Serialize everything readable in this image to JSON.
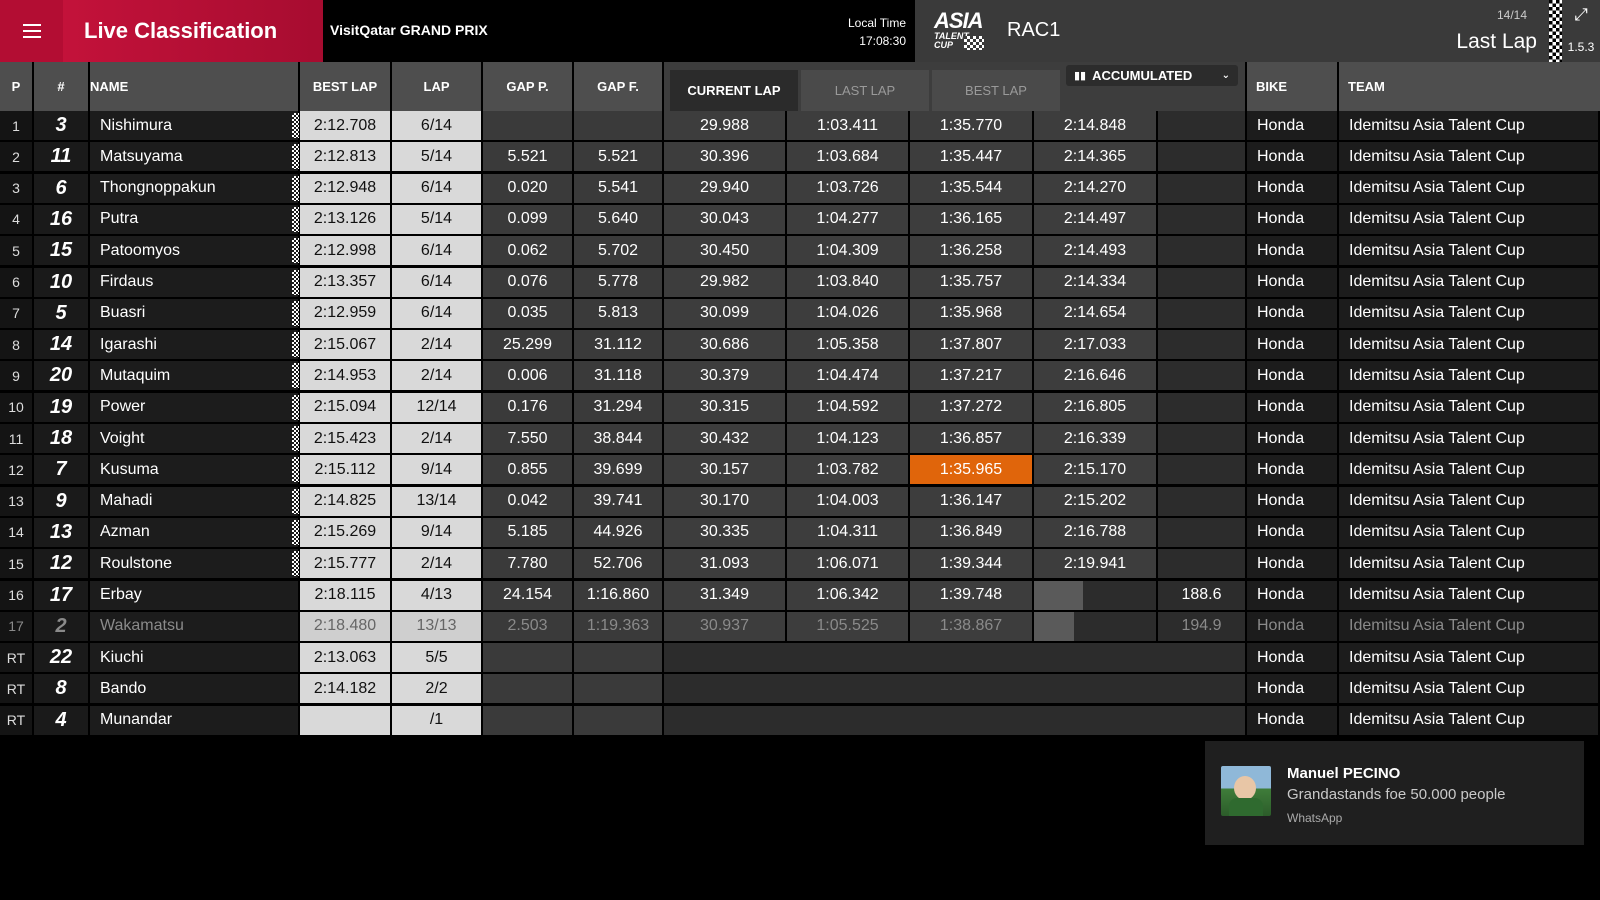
{
  "header": {
    "title": "Live Classification",
    "event": "VisitQatar GRAND PRIX",
    "local_time_label": "Local Time",
    "local_time": "17:08:30",
    "logo_line1": "ASIA",
    "logo_line2": "TALENT",
    "logo_line3": "CUP",
    "session": "RAC1",
    "lap_count": "14/14",
    "lap_mode": "Last Lap",
    "version": "1.5.3"
  },
  "columns": {
    "p": "P",
    "num": "#",
    "name": "NAME",
    "best_lap": "BEST LAP",
    "lap": "LAP",
    "gap_p": "GAP P.",
    "gap_f": "GAP F.",
    "bike": "BIKE",
    "team": "TEAM"
  },
  "sector_tabs": [
    "CURRENT LAP",
    "LAST LAP",
    "BEST LAP"
  ],
  "accumulated_label": "ACCUMULATED",
  "rows": [
    {
      "p": "1",
      "num": "3",
      "name": "Nishimura",
      "best": "2:12.708",
      "lap": "6/14",
      "gap_p": "",
      "gap_f": "",
      "s1": "29.988",
      "s2": "1:03.411",
      "s3": "1:35.770",
      "s4": "2:14.848",
      "speed": "",
      "bike": "Honda",
      "team": "Idemitsu Asia Talent Cup",
      "flag": true
    },
    {
      "p": "2",
      "num": "11",
      "name": "Matsuyama",
      "best": "2:12.813",
      "lap": "5/14",
      "gap_p": "5.521",
      "gap_f": "5.521",
      "s1": "30.396",
      "s2": "1:03.684",
      "s3": "1:35.447",
      "s4": "2:14.365",
      "speed": "",
      "bike": "Honda",
      "team": "Idemitsu Asia Talent Cup",
      "flag": true
    },
    {
      "p": "3",
      "num": "6",
      "name": "Thongnoppakun",
      "best": "2:12.948",
      "lap": "6/14",
      "gap_p": "0.020",
      "gap_f": "5.541",
      "s1": "29.940",
      "s2": "1:03.726",
      "s3": "1:35.544",
      "s4": "2:14.270",
      "speed": "",
      "bike": "Honda",
      "team": "Idemitsu Asia Talent Cup",
      "flag": true
    },
    {
      "p": "4",
      "num": "16",
      "name": "Putra",
      "best": "2:13.126",
      "lap": "5/14",
      "gap_p": "0.099",
      "gap_f": "5.640",
      "s1": "30.043",
      "s2": "1:04.277",
      "s3": "1:36.165",
      "s4": "2:14.497",
      "speed": "",
      "bike": "Honda",
      "team": "Idemitsu Asia Talent Cup",
      "flag": true
    },
    {
      "p": "5",
      "num": "15",
      "name": "Patoomyos",
      "best": "2:12.998",
      "lap": "6/14",
      "gap_p": "0.062",
      "gap_f": "5.702",
      "s1": "30.450",
      "s2": "1:04.309",
      "s3": "1:36.258",
      "s4": "2:14.493",
      "speed": "",
      "bike": "Honda",
      "team": "Idemitsu Asia Talent Cup",
      "flag": true
    },
    {
      "p": "6",
      "num": "10",
      "name": "Firdaus",
      "best": "2:13.357",
      "lap": "6/14",
      "gap_p": "0.076",
      "gap_f": "5.778",
      "s1": "29.982",
      "s2": "1:03.840",
      "s3": "1:35.757",
      "s4": "2:14.334",
      "speed": "",
      "bike": "Honda",
      "team": "Idemitsu Asia Talent Cup",
      "flag": true
    },
    {
      "p": "7",
      "num": "5",
      "name": "Buasri",
      "best": "2:12.959",
      "lap": "6/14",
      "gap_p": "0.035",
      "gap_f": "5.813",
      "s1": "30.099",
      "s2": "1:04.026",
      "s3": "1:35.968",
      "s4": "2:14.654",
      "speed": "",
      "bike": "Honda",
      "team": "Idemitsu Asia Talent Cup",
      "flag": true
    },
    {
      "p": "8",
      "num": "14",
      "name": "Igarashi",
      "best": "2:15.067",
      "lap": "2/14",
      "gap_p": "25.299",
      "gap_f": "31.112",
      "s1": "30.686",
      "s2": "1:05.358",
      "s3": "1:37.807",
      "s4": "2:17.033",
      "speed": "",
      "bike": "Honda",
      "team": "Idemitsu Asia Talent Cup",
      "flag": true
    },
    {
      "p": "9",
      "num": "20",
      "name": "Mutaquim",
      "best": "2:14.953",
      "lap": "2/14",
      "gap_p": "0.006",
      "gap_f": "31.118",
      "s1": "30.379",
      "s2": "1:04.474",
      "s3": "1:37.217",
      "s4": "2:16.646",
      "speed": "",
      "bike": "Honda",
      "team": "Idemitsu Asia Talent Cup",
      "flag": true
    },
    {
      "p": "10",
      "num": "19",
      "name": "Power",
      "best": "2:15.094",
      "lap": "12/14",
      "gap_p": "0.176",
      "gap_f": "31.294",
      "s1": "30.315",
      "s2": "1:04.592",
      "s3": "1:37.272",
      "s4": "2:16.805",
      "speed": "",
      "bike": "Honda",
      "team": "Idemitsu Asia Talent Cup",
      "flag": true
    },
    {
      "p": "11",
      "num": "18",
      "name": "Voight",
      "best": "2:15.423",
      "lap": "2/14",
      "gap_p": "7.550",
      "gap_f": "38.844",
      "s1": "30.432",
      "s2": "1:04.123",
      "s3": "1:36.857",
      "s4": "2:16.339",
      "speed": "",
      "bike": "Honda",
      "team": "Idemitsu Asia Talent Cup",
      "flag": true
    },
    {
      "p": "12",
      "num": "7",
      "name": "Kusuma",
      "best": "2:15.112",
      "lap": "9/14",
      "gap_p": "0.855",
      "gap_f": "39.699",
      "s1": "30.157",
      "s2": "1:03.782",
      "s3": "1:35.965",
      "s4": "2:15.170",
      "speed": "",
      "bike": "Honda",
      "team": "Idemitsu Asia Talent Cup",
      "flag": true,
      "highlight_s3": true
    },
    {
      "p": "13",
      "num": "9",
      "name": "Mahadi",
      "best": "2:14.825",
      "lap": "13/14",
      "gap_p": "0.042",
      "gap_f": "39.741",
      "s1": "30.170",
      "s2": "1:04.003",
      "s3": "1:36.147",
      "s4": "2:15.202",
      "speed": "",
      "bike": "Honda",
      "team": "Idemitsu Asia Talent Cup",
      "flag": true
    },
    {
      "p": "14",
      "num": "13",
      "name": "Azman",
      "best": "2:15.269",
      "lap": "9/14",
      "gap_p": "5.185",
      "gap_f": "44.926",
      "s1": "30.335",
      "s2": "1:04.311",
      "s3": "1:36.849",
      "s4": "2:16.788",
      "speed": "",
      "bike": "Honda",
      "team": "Idemitsu Asia Talent Cup",
      "flag": true
    },
    {
      "p": "15",
      "num": "12",
      "name": "Roulstone",
      "best": "2:15.777",
      "lap": "2/14",
      "gap_p": "7.780",
      "gap_f": "52.706",
      "s1": "31.093",
      "s2": "1:06.071",
      "s3": "1:39.344",
      "s4": "2:19.941",
      "speed": "",
      "bike": "Honda",
      "team": "Idemitsu Asia Talent Cup",
      "flag": true
    },
    {
      "p": "16",
      "num": "17",
      "name": "Erbay",
      "best": "2:18.115",
      "lap": "4/13",
      "gap_p": "24.154",
      "gap_f": "1:16.860",
      "s1": "31.349",
      "s2": "1:06.342",
      "s3": "1:39.748",
      "s4": "",
      "speed": "188.6",
      "bike": "Honda",
      "team": "Idemitsu Asia Talent Cup",
      "flag": false,
      "s4_progress": 0.4
    },
    {
      "p": "17",
      "num": "2",
      "name": "Wakamatsu",
      "best": "2:18.480",
      "lap": "13/13",
      "gap_p": "2.503",
      "gap_f": "1:19.363",
      "s1": "30.937",
      "s2": "1:05.525",
      "s3": "1:38.867",
      "s4": "",
      "speed": "194.9",
      "bike": "Honda",
      "team": "Idemitsu Asia Talent Cup",
      "flag": false,
      "dim": true,
      "s4_progress": 0.33
    },
    {
      "p": "RT",
      "num": "22",
      "name": "Kiuchi",
      "best": "2:13.063",
      "lap": "5/5",
      "gap_p": "",
      "gap_f": "",
      "s1": "",
      "s2": "",
      "s3": "",
      "s4": "",
      "speed": "",
      "bike": "Honda",
      "team": "Idemitsu Asia Talent Cup",
      "flag": false,
      "retired": true
    },
    {
      "p": "RT",
      "num": "8",
      "name": "Bando",
      "best": "2:14.182",
      "lap": "2/2",
      "gap_p": "",
      "gap_f": "",
      "s1": "",
      "s2": "",
      "s3": "",
      "s4": "",
      "speed": "",
      "bike": "Honda",
      "team": "Idemitsu Asia Talent Cup",
      "flag": false,
      "retired": true
    },
    {
      "p": "RT",
      "num": "4",
      "name": "Munandar",
      "best": "",
      "lap": "/1",
      "gap_p": "",
      "gap_f": "",
      "s1": "",
      "s2": "",
      "s3": "",
      "s4": "",
      "speed": "",
      "bike": "Honda",
      "team": "Idemitsu Asia Talent Cup",
      "flag": false,
      "retired": true
    }
  ],
  "notification": {
    "sender": "Manuel PECINO",
    "message": "Grandastands foe 50.000 people",
    "app": "WhatsApp"
  },
  "colors": {
    "accent_red": "#c3123a",
    "best_sector_orange": "#e0650b"
  }
}
